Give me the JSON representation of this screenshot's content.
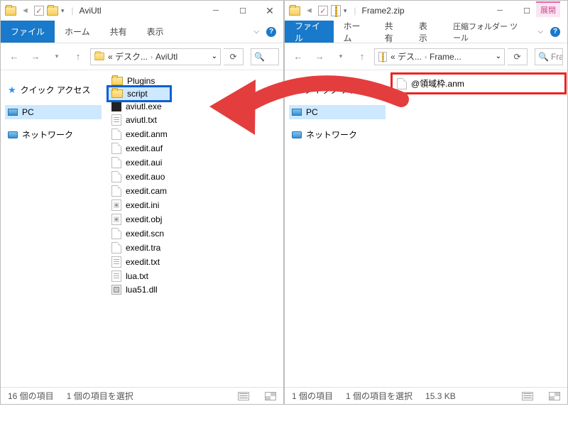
{
  "left": {
    "title": "AviUtl",
    "tabs": {
      "file": "ファイル",
      "home": "ホーム",
      "share": "共有",
      "view": "表示"
    },
    "breadcrumb": {
      "prefix": "« デスク...",
      "current": "AviUtl"
    },
    "search_placeholder": "",
    "nav": {
      "quick": "クイック アクセス",
      "pc": "PC",
      "network": "ネットワーク"
    },
    "files": [
      {
        "name": "Plugins",
        "type": "folder"
      },
      {
        "name": "script",
        "type": "folder",
        "highlight": "blue"
      },
      {
        "name": "aviutl.exe",
        "type": "exe"
      },
      {
        "name": "aviutl.txt",
        "type": "txt"
      },
      {
        "name": "exedit.anm",
        "type": "file"
      },
      {
        "name": "exedit.auf",
        "type": "file"
      },
      {
        "name": "exedit.aui",
        "type": "file"
      },
      {
        "name": "exedit.auo",
        "type": "file"
      },
      {
        "name": "exedit.cam",
        "type": "file"
      },
      {
        "name": "exedit.ini",
        "type": "ini"
      },
      {
        "name": "exedit.obj",
        "type": "obj"
      },
      {
        "name": "exedit.scn",
        "type": "file"
      },
      {
        "name": "exedit.tra",
        "type": "file"
      },
      {
        "name": "exedit.txt",
        "type": "txt"
      },
      {
        "name": "lua.txt",
        "type": "txt"
      },
      {
        "name": "lua51.dll",
        "type": "dll"
      }
    ],
    "status": {
      "count": "16 個の項目",
      "selected": "1 個の項目を選択"
    }
  },
  "right": {
    "title": "Frame2.zip",
    "tabs": {
      "file": "ファイル",
      "home": "ホーム",
      "share": "共有",
      "view": "表示",
      "context": "圧縮フォルダー ツール"
    },
    "breadcrumb": {
      "prefix": "« デス...",
      "current": "Frame..."
    },
    "search_placeholder": "Fra",
    "nav": {
      "quick": "クイック アクセス",
      "pc": "PC",
      "network": "ネットワーク"
    },
    "files": [
      {
        "name": "@領域枠.anm",
        "type": "file",
        "highlight": "red"
      }
    ],
    "status": {
      "count": "1 個の項目",
      "selected": "1 個の項目を選択",
      "size": "15.3 KB"
    }
  },
  "context_tab_label": "展開"
}
